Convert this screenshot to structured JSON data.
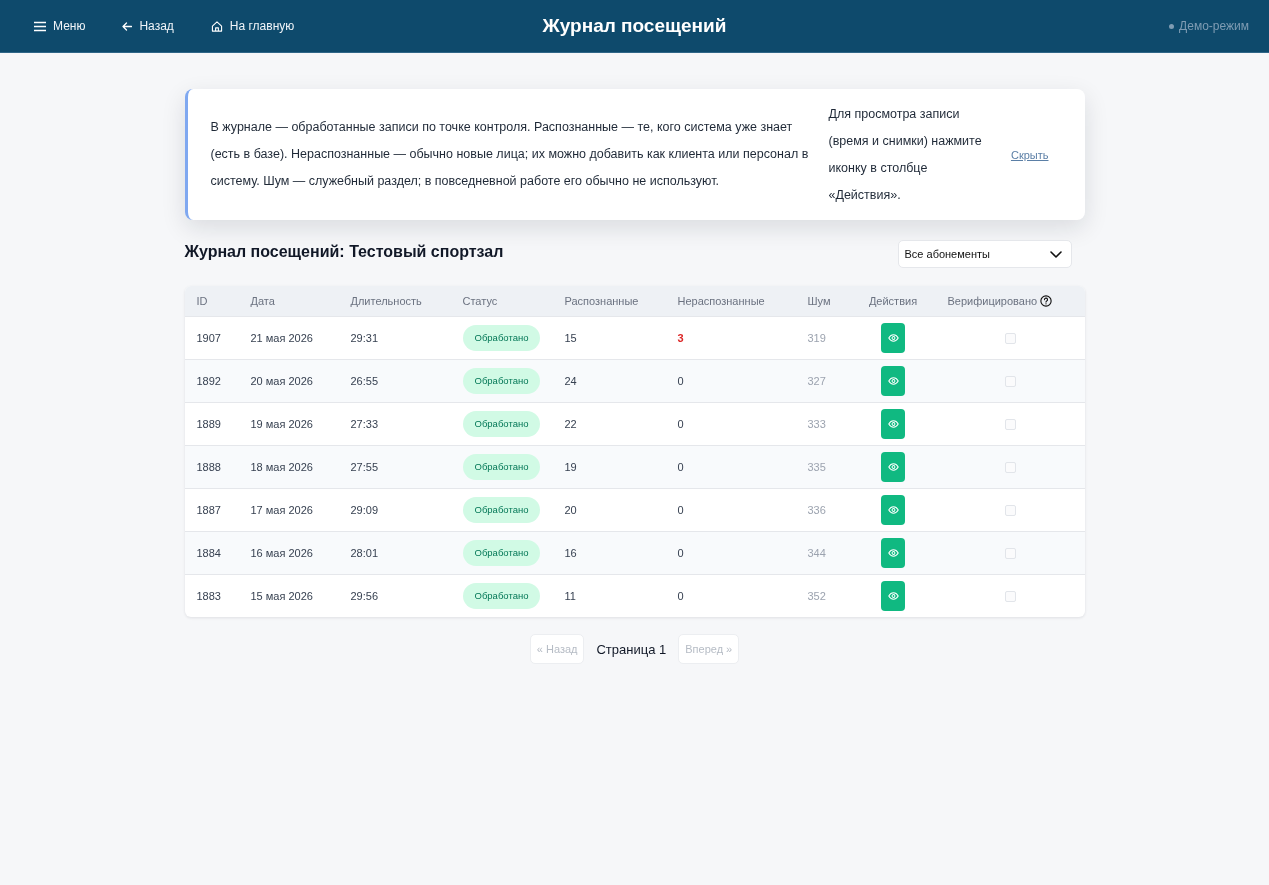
{
  "header": {
    "nav": [
      {
        "label": "Меню",
        "kind": "menu"
      },
      {
        "label": "Назад",
        "kind": "back"
      },
      {
        "label": "На главную",
        "kind": "home"
      }
    ],
    "title": "Журнал посещений",
    "mode": "Демо-режим"
  },
  "info": {
    "text": "В журнале — обработанные записи по точке контроля. Распознанные — те, кого система уже знает (есть в базе). Нераспознанные — обычно новые лица; их можно добавить как клиента или персонал в систему. Шум — служебный раздел; в повседневной работе его обычно не используют.",
    "hint": "Для просмотра записи (время и снимки) нажмите иконку в столбце «Действия».",
    "hide_link": "Скрыть"
  },
  "section_title": "Журнал посещений: Тестовый спортзал",
  "filter": {
    "value": "Все абонементы"
  },
  "table": {
    "columns": [
      "ID",
      "Дата",
      "Длительность",
      "Статус",
      "Распознанные",
      "Нераспознанные",
      "Шум",
      "Действия",
      "Верифицировано"
    ],
    "rows": [
      {
        "id": "1907",
        "date": "21 мая 2026",
        "duration": "29:31",
        "status": {
          "label": "Обработано",
          "kind": "processed"
        },
        "recognized": "15",
        "unrecognized": "3",
        "unrecognized_alert": true,
        "noise": "319",
        "verified": false
      },
      {
        "id": "1892",
        "date": "20 мая 2026",
        "duration": "26:55",
        "status": {
          "label": "Обработано",
          "kind": "processed"
        },
        "recognized": "24",
        "unrecognized": "0",
        "unrecognized_alert": false,
        "noise": "327",
        "verified": false
      },
      {
        "id": "1889",
        "date": "19 мая 2026",
        "duration": "27:33",
        "status": {
          "label": "Обработано",
          "kind": "processed"
        },
        "recognized": "22",
        "unrecognized": "0",
        "unrecognized_alert": false,
        "noise": "333",
        "verified": false
      },
      {
        "id": "1888",
        "date": "18 мая 2026",
        "duration": "27:55",
        "status": {
          "label": "Обработано",
          "kind": "processed"
        },
        "recognized": "19",
        "unrecognized": "0",
        "unrecognized_alert": false,
        "noise": "335",
        "verified": false
      },
      {
        "id": "1887",
        "date": "17 мая 2026",
        "duration": "29:09",
        "status": {
          "label": "Обработано",
          "kind": "processed"
        },
        "recognized": "20",
        "unrecognized": "0",
        "unrecognized_alert": false,
        "noise": "336",
        "verified": false
      },
      {
        "id": "1884",
        "date": "16 мая 2026",
        "duration": "28:01",
        "status": {
          "label": "Обработано",
          "kind": "processed"
        },
        "recognized": "16",
        "unrecognized": "0",
        "unrecognized_alert": false,
        "noise": "344",
        "verified": false
      },
      {
        "id": "1883",
        "date": "15 мая 2026",
        "duration": "29:56",
        "status": {
          "label": "Обработано",
          "kind": "processed"
        },
        "recognized": "11",
        "unrecognized": "0",
        "unrecognized_alert": false,
        "noise": "352",
        "verified": false
      }
    ]
  },
  "pagination": {
    "prev": {
      "label": "« Назад",
      "disabled": true
    },
    "page": "Страница 1",
    "next": {
      "label": "Вперед »",
      "disabled": true
    }
  }
}
